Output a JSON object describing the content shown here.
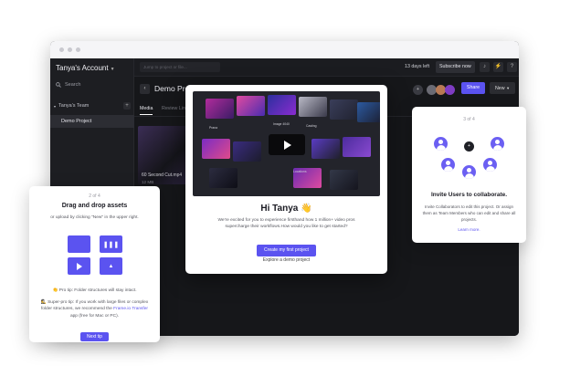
{
  "app": {
    "account_name": "Tanya's Account",
    "search_label": "Search",
    "team_name": "Tanya's Team",
    "project_item": "Demo Project",
    "jump_placeholder": "Jump to project or file...",
    "trial_status": "13 days left",
    "subscribe_label": "Subscribe now",
    "project_title": "Demo Project",
    "share_label": "Share",
    "new_label": "New",
    "tabs": [
      "Media",
      "Review Links"
    ],
    "asset_name": "60 Second Cut.mp4",
    "asset_size": "12 MB"
  },
  "left_card": {
    "step": "2 of 4",
    "title": "Drag and drop assets",
    "subtitle": "or upload by clicking \"New\" in the upper right.",
    "tip_emoji": "👏",
    "tip": "Pro tip: Folder structures will stay intact.",
    "super_tip_emoji": "🕵️",
    "super_tip": "Super-pro tip: If you work with large files or complex folder structures, we recommend the",
    "super_tip_link": "Frame.io Transfer",
    "super_tip_end": "app (free for Mac or PC).",
    "button": "Next tip"
  },
  "center_card": {
    "title": "Hi Tanya",
    "title_emoji": "👋",
    "body": "We're excited for you to experience firsthand how 1 million+ video pros supercharge their workflows.How would you like to get started?",
    "primary_button": "Create my first project",
    "secondary_link": "Explore a demo project",
    "preview_labels": [
      "Prana",
      "Image 4040",
      "Casting",
      "Locations"
    ]
  },
  "right_card": {
    "step": "3 of 4",
    "title": "Invite Users to collaborate.",
    "body": "Invite Collaborators to edit this project. Or assign them as Team Members who can edit and share all projects.",
    "link": "Learn more."
  },
  "colors": {
    "accent": "#5b53f0",
    "app_background": "#16171a"
  }
}
